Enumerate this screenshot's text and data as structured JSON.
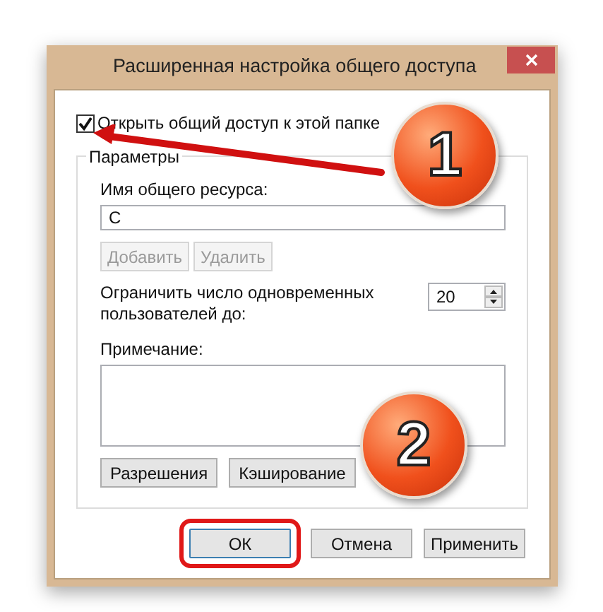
{
  "window": {
    "title": "Расширенная настройка общего доступа"
  },
  "share_checkbox": {
    "label": "Открыть общий доступ к этой папке",
    "checked": true
  },
  "group": {
    "title": "Параметры",
    "share_name": {
      "label": "Имя общего ресурса:",
      "value": "C"
    },
    "name_buttons": [
      {
        "label": "Добавить",
        "disabled": true
      },
      {
        "label": "Удалить",
        "disabled": true
      }
    ],
    "limit": {
      "label": "Ограничить число одновременных пользователей до:",
      "value": "20"
    },
    "comment": {
      "label": "Примечание:"
    },
    "buttons": [
      {
        "label": "Разрешения"
      },
      {
        "label": "Кэширование"
      }
    ]
  },
  "buttons": [
    {
      "label": "ОК",
      "highlighted": true
    },
    {
      "label": "Отмена",
      "highlighted": false
    },
    {
      "label": "Применить",
      "highlighted": false
    }
  ],
  "annotations": [
    {
      "label": "1"
    },
    {
      "label": "2"
    }
  ]
}
